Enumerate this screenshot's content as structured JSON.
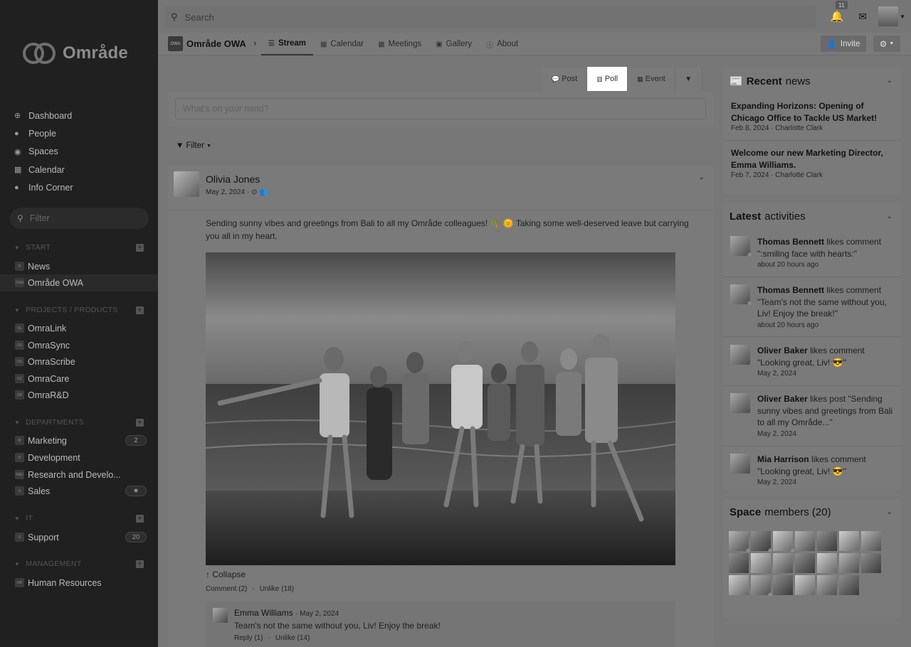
{
  "sidebar": {
    "logo_text": "Område",
    "nav": [
      {
        "label": "Dashboard",
        "icon": "dashboard-icon"
      },
      {
        "label": "People",
        "icon": "people-icon"
      },
      {
        "label": "Spaces",
        "icon": "spaces-icon"
      },
      {
        "label": "Calendar",
        "icon": "calendar-icon"
      },
      {
        "label": "Info Corner",
        "icon": "info-icon"
      }
    ],
    "filter_placeholder": "Filter",
    "sections": [
      {
        "title": "START",
        "items": [
          {
            "label": "News",
            "abbr": "N"
          },
          {
            "label": "Område OWA",
            "abbr": "OWA",
            "active": true
          }
        ]
      },
      {
        "title": "PROJECTS / PRODUCTS",
        "items": [
          {
            "label": "OmraLink",
            "abbr": "OL"
          },
          {
            "label": "OmraSync",
            "abbr": "OS"
          },
          {
            "label": "OmraScribe",
            "abbr": "OS"
          },
          {
            "label": "OmraCare",
            "abbr": "OC"
          },
          {
            "label": "OmraR&D",
            "abbr": "OR"
          }
        ]
      },
      {
        "title": "DEPARTMENTS",
        "items": [
          {
            "label": "Marketing",
            "abbr": "M",
            "badge": "2"
          },
          {
            "label": "Development",
            "abbr": "D"
          },
          {
            "label": "Research and Develo...",
            "abbr": "R&D"
          },
          {
            "label": "Sales",
            "abbr": "S",
            "badge": "★"
          }
        ]
      },
      {
        "title": "IT",
        "items": [
          {
            "label": "Support",
            "abbr": "S",
            "badge": "20"
          }
        ]
      },
      {
        "title": "MANAGEMENT",
        "items": [
          {
            "label": "Human Resources",
            "abbr": "HR"
          }
        ]
      }
    ]
  },
  "topbar": {
    "search_placeholder": "Search",
    "notification_count": "11"
  },
  "space": {
    "icon_abbr": "OWA",
    "name": "Område OWA",
    "tabs": [
      {
        "label": "Stream",
        "icon": "stream-icon",
        "active": true
      },
      {
        "label": "Calendar",
        "icon": "calendar-icon"
      },
      {
        "label": "Meetings",
        "icon": "meetings-icon"
      },
      {
        "label": "Gallery",
        "icon": "gallery-icon"
      },
      {
        "label": "About",
        "icon": "about-icon"
      }
    ],
    "invite_label": "Invite"
  },
  "composer": {
    "tabs": [
      {
        "label": "Post",
        "icon": "comment-icon"
      },
      {
        "label": "Poll",
        "icon": "poll-icon",
        "active": true
      },
      {
        "label": "Event",
        "icon": "event-icon"
      }
    ],
    "placeholder": "What's on your mind?",
    "filter_label": "Filter"
  },
  "post": {
    "author": "Olivia Jones",
    "date": "May 2, 2024 ·",
    "text": "Sending sunny vibes and greetings from Bali to all my Område colleagues! 🌴 🌞 Taking some well-deserved leave but carrying you all in my heart.",
    "collapse_label": "Collapse",
    "comment_link": "Comment (2)",
    "unlike_link": "Unlike (18)",
    "comment": {
      "author": "Emma Williams",
      "date": "May 2, 2024",
      "text": "Team's not the same without you, Liv! Enjoy the break!",
      "reply": "Reply (1)",
      "unlike": "Unlike (14)"
    }
  },
  "recent_news": {
    "title_bold": "Recent",
    "title_rest": "news",
    "items": [
      {
        "title": "Expanding Horizons: Opening of Chicago Office to Tackle US Market!",
        "meta": "Feb 8, 2024 · Charlotte Clark"
      },
      {
        "title": "Welcome our new Marketing Director, Emma Williams.",
        "meta": "Feb 7, 2024 · Charlotte Clark"
      }
    ]
  },
  "latest_activities": {
    "title_bold": "Latest",
    "title_rest": "activities",
    "items": [
      {
        "user": "Thomas Bennett",
        "action": "likes comment \":smiling face with hearts:\"",
        "time": "about 20 hours ago"
      },
      {
        "user": "Thomas Bennett",
        "action": "likes comment \"Team's not the same without you, Liv! Enjoy the break!\"",
        "time": "about 20 hours ago"
      },
      {
        "user": "Oliver Baker",
        "action": "likes comment \"Looking great, Liv! 😎\"",
        "time": "May 2, 2024"
      },
      {
        "user": "Oliver Baker",
        "action": "likes post \"Sending sunny vibes and greetings from Bali to all my Område...\"",
        "time": "May 2, 2024"
      },
      {
        "user": "Mia Harrison",
        "action": "likes comment \"Looking great, Liv! 😎\"",
        "time": "May 2, 2024"
      }
    ]
  },
  "space_members": {
    "title_bold": "Space",
    "title_rest": "members (20)",
    "count": 20
  }
}
